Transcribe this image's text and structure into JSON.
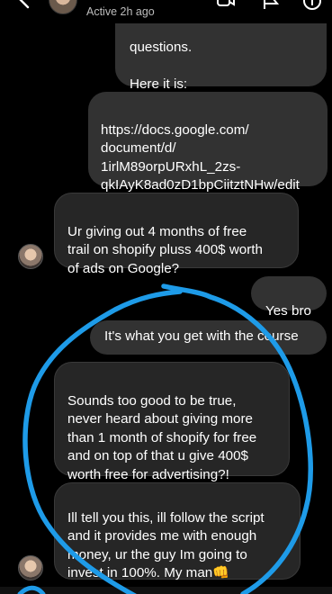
{
  "header": {
    "status": "Active 2h ago",
    "icons": [
      "chevron-left-icon",
      "video-icon",
      "flag-icon",
      "info-icon"
    ]
  },
  "messages": [
    {
      "id": "m1",
      "side": "out",
      "text": "questions.\n\nHere it is:"
    },
    {
      "id": "m2",
      "side": "out",
      "text": "https://docs.google.com/\ndocument/d/\n1irlM89orpURxhL_2zs-\nqkIAyK8ad0zD1bpCiitztNHw/edit"
    },
    {
      "id": "m3",
      "side": "in",
      "text": "Ur giving out 4 months of free\ntrail on shopify pluss 400$ worth\nof ads on Google?"
    },
    {
      "id": "m4",
      "side": "out",
      "text": "Yes bro"
    },
    {
      "id": "m5",
      "side": "out",
      "text": "It's what you get with the course"
    },
    {
      "id": "m6",
      "side": "in",
      "text": "Sounds too good to be true,\nnever heard about giving more\nthan 1 month of shopify for free\nand on top of that u give 400$\nworth free for advertising?!"
    },
    {
      "id": "m7",
      "side": "in",
      "text": "Ill tell you this, ill follow the script\nand it provides me with enough\nmoney, ur the guy Im going to\ninvest in 100%. My man👊"
    }
  ],
  "annotation": {
    "color": "#1e9be8",
    "shape": "freehand-circle-stroke"
  }
}
